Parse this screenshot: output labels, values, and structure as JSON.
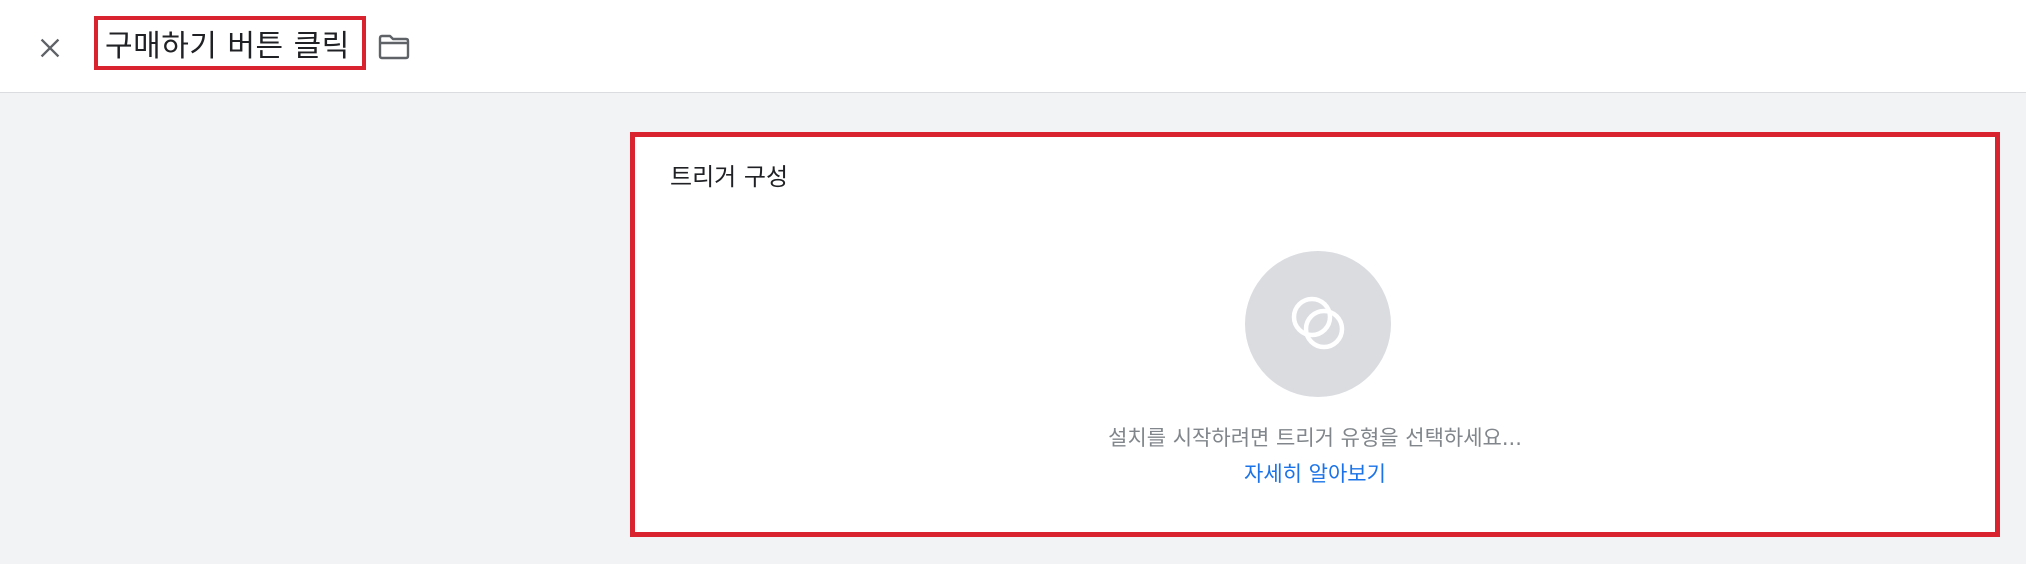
{
  "header": {
    "close_icon": "close-icon",
    "title": "구매하기 버튼 클릭",
    "folder_icon": "folder-icon"
  },
  "trigger_config": {
    "title": "트리거 구성",
    "trigger_icon": "trigger-type-icon",
    "prompt": "설치를 시작하려면 트리거 유형을 선택하세요...",
    "learn_more": "자세히 알아보기"
  },
  "colors": {
    "highlight_border": "#d9232f",
    "link": "#1a73e8",
    "icon_circle": "#dadce0",
    "page_background": "#f1f3f4"
  }
}
